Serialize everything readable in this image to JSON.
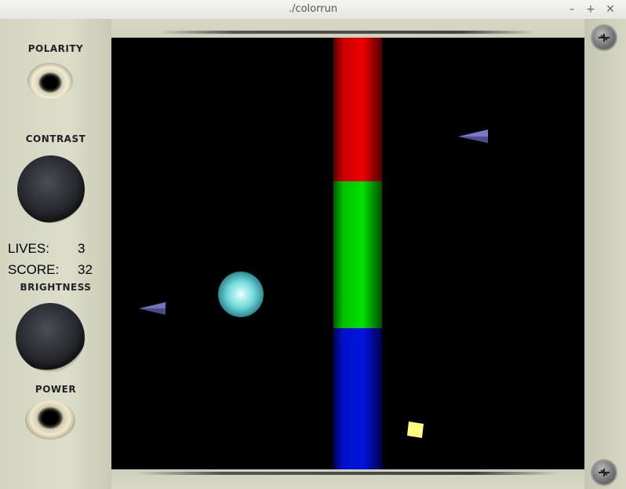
{
  "window": {
    "title": "./colorrun",
    "minimize_glyph": "–",
    "maximize_glyph": "+",
    "close_glyph": "✕"
  },
  "controls": {
    "polarity_label": "POLARITY",
    "contrast_label": "CONTRAST",
    "brightness_label": "BRIGHTNESS",
    "power_label": "POWER"
  },
  "hud": {
    "lives_label": "LIVES:",
    "lives_value": "3",
    "score_label": "SCORE:",
    "score_value": "32"
  },
  "game": {
    "bar_colors": [
      "#e00000",
      "#00d400",
      "#0010d8"
    ],
    "player_color": "#7fe3e6",
    "enemy_color": "#6f6fb8",
    "pickup_color": "#ffff80"
  }
}
